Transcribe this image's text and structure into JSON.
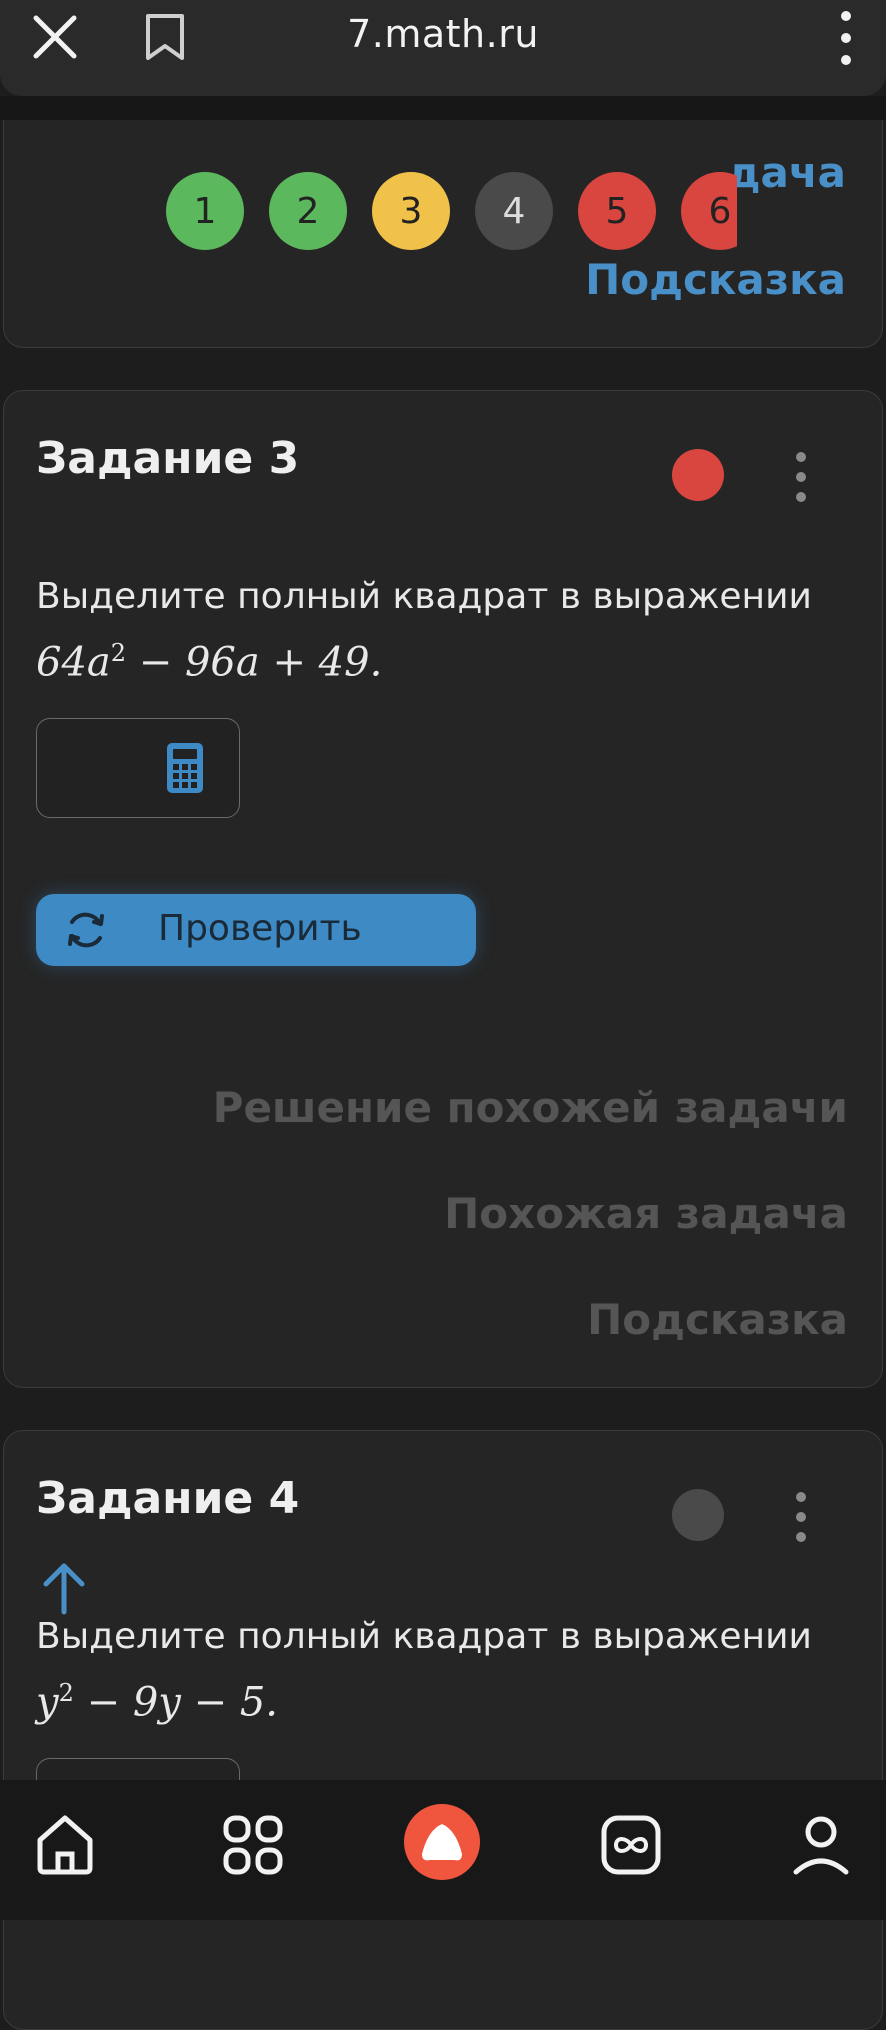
{
  "browser": {
    "url": "7.math.ru"
  },
  "previous_task": {
    "attempt_dots": [
      {
        "label": "1",
        "color": "#5cb85c"
      },
      {
        "label": "2",
        "color": "#5cb85c"
      },
      {
        "label": "3",
        "color": "#f0c24a"
      },
      {
        "label": "4",
        "color": "#4a4a4a"
      },
      {
        "label": "5",
        "color": "#d9463f"
      },
      {
        "label": "6",
        "color": "#d9463f"
      }
    ],
    "link_similar_partial": "дача",
    "link_hint_partial": "Подсказка"
  },
  "task3": {
    "title": "Задание 3",
    "status_color": "#d9463f",
    "text": "Выделите полный квадрат в выражении",
    "expr": {
      "a": "64a",
      "sup": "2",
      "b": " − 96a + 49."
    },
    "check_label": "Проверить",
    "links": {
      "solution": "Решение похожей задачи",
      "similar": "Похожая задача",
      "hint": "Подсказка"
    }
  },
  "task4": {
    "title": "Задание 4",
    "status_color": "#4a4a4a",
    "text": "Выделите полный квадрат в выражении",
    "expr": {
      "a": "y",
      "sup": "2",
      "b": " − 9y − 5."
    }
  },
  "bottom_nav": [
    "home-icon",
    "apps-grid-icon",
    "alice-assistant-icon",
    "infinity-icon",
    "profile-icon"
  ],
  "accent": "#3d8ac5"
}
